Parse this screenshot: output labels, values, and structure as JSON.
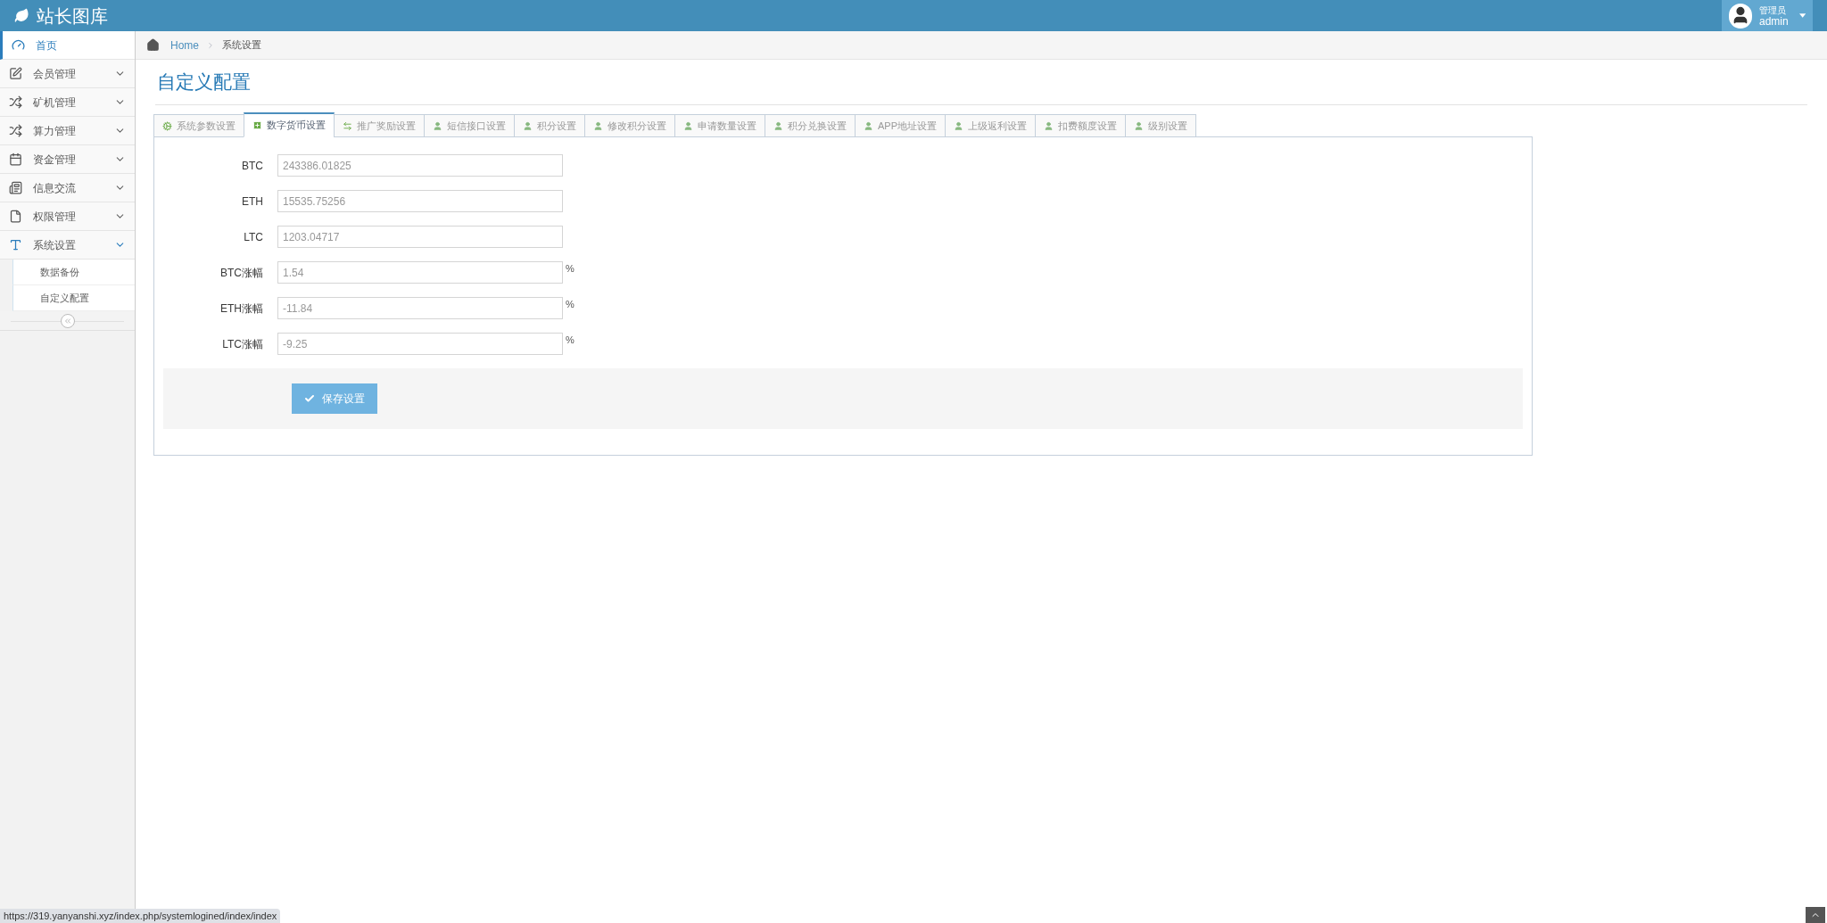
{
  "header": {
    "brand": "站长图库",
    "user": {
      "role": "管理员",
      "name": "admin"
    }
  },
  "sidebar": {
    "items": [
      {
        "label": "首页",
        "kind": "link",
        "selected": true,
        "expanded": false
      },
      {
        "label": "会员管理",
        "kind": "menu",
        "selected": false,
        "expanded": false
      },
      {
        "label": "矿机管理",
        "kind": "menu",
        "selected": false,
        "expanded": false
      },
      {
        "label": "算力管理",
        "kind": "menu",
        "selected": false,
        "expanded": false
      },
      {
        "label": "资金管理",
        "kind": "menu",
        "selected": false,
        "expanded": false
      },
      {
        "label": "信息交流",
        "kind": "menu",
        "selected": false,
        "expanded": false
      },
      {
        "label": "权限管理",
        "kind": "menu",
        "selected": false,
        "expanded": false
      },
      {
        "label": "系统设置",
        "kind": "menu",
        "selected": false,
        "expanded": true,
        "children": [
          {
            "label": "数据备份",
            "selected": false
          },
          {
            "label": "自定义配置",
            "selected": false
          }
        ]
      }
    ]
  },
  "breadcrumb": [
    "Home",
    "系统设置"
  ],
  "page_title": "自定义配置",
  "tabs": [
    {
      "label": "系统参数设置",
      "selected": false
    },
    {
      "label": "数字货币设置",
      "selected": true
    },
    {
      "label": "推广奖励设置",
      "selected": false
    },
    {
      "label": "短信接口设置",
      "selected": false
    },
    {
      "label": "积分设置",
      "selected": false
    },
    {
      "label": "修改积分设置",
      "selected": false
    },
    {
      "label": "申请数量设置",
      "selected": false
    },
    {
      "label": "积分兑换设置",
      "selected": false
    },
    {
      "label": "APP地址设置",
      "selected": false
    },
    {
      "label": "上级返利设置",
      "selected": false
    },
    {
      "label": "扣费额度设置",
      "selected": false
    },
    {
      "label": "级别设置",
      "selected": false
    }
  ],
  "form": {
    "fields": [
      {
        "label": "BTC",
        "value": "243386.01825"
      },
      {
        "label": "ETH",
        "value": "15535.75256"
      },
      {
        "label": "LTC",
        "value": "1203.04717"
      },
      {
        "label": "BTC涨幅",
        "value": "1.54",
        "unit": "%"
      },
      {
        "label": "ETH涨幅",
        "value": "-11.84",
        "unit": "%"
      },
      {
        "label": "LTC涨幅",
        "value": "-9.25",
        "unit": "%"
      }
    ],
    "submit": "保存设置"
  },
  "status_bar": {
    "url": "https://319.yanyanshi.xyz/index.php/systemlogined/index/index"
  }
}
